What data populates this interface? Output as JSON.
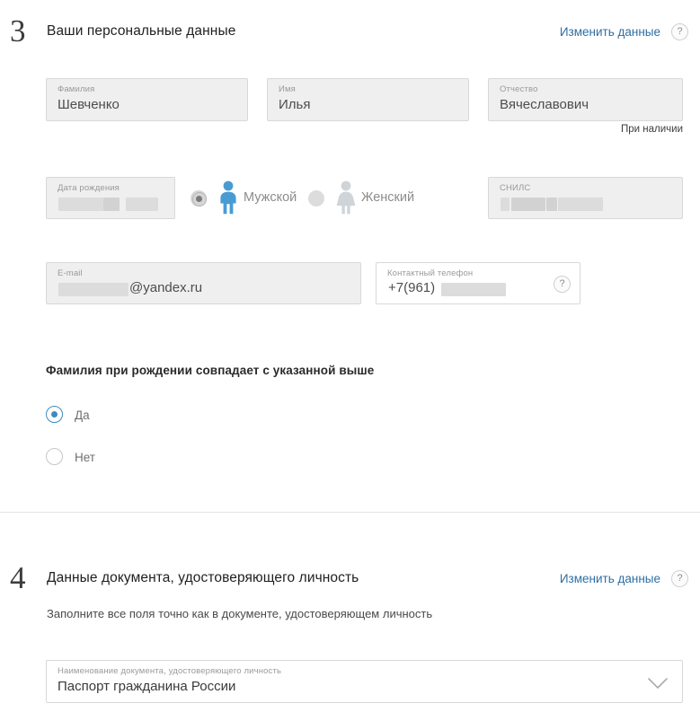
{
  "section3": {
    "number": "3",
    "title": "Ваши персональные данные",
    "edit_link": "Изменить данные",
    "help_icon": "question-mark-icon",
    "help_glyph": "?",
    "fields": {
      "lastname": {
        "label": "Фамилия",
        "value": "Шевченко"
      },
      "firstname": {
        "label": "Имя",
        "value": "Илья"
      },
      "middlename": {
        "label": "Отчество",
        "value": "Вячеславович",
        "hint": "При наличии"
      },
      "birthdate": {
        "label": "Дата рождения",
        "value": "",
        "redacted": true
      },
      "snils": {
        "label": "СНИЛС",
        "value": "",
        "redacted": true
      },
      "email": {
        "label": "E-mail",
        "value": "@yandex.ru",
        "redacted": true
      },
      "phone": {
        "label": "Контактный телефон",
        "value": "+7(961)",
        "redacted": true,
        "help_glyph": "?"
      }
    },
    "gender": {
      "male": {
        "label": "Мужской",
        "selected": true,
        "icon": "male-person-icon"
      },
      "female": {
        "label": "Женский",
        "selected": false,
        "icon": "female-person-icon"
      }
    },
    "birth_surname_question": {
      "title": "Фамилия при рождении совпадает с указанной выше",
      "options": [
        {
          "label": "Да",
          "selected": true
        },
        {
          "label": "Нет",
          "selected": false
        }
      ]
    }
  },
  "section4": {
    "number": "4",
    "title": "Данные документа, удостоверяющего личность",
    "edit_link": "Изменить данные",
    "help_glyph": "?",
    "subtitle": "Заполните все поля точно как в документе, удостоверяющем личность",
    "document_select": {
      "label": "Наименование документа, удостоверяющего личность",
      "value": "Паспорт гражданина России",
      "chevron": "chevron-down-icon"
    }
  },
  "colors": {
    "link": "#2e6ea3",
    "accent_radio": "#3d8bbf",
    "male_icon": "#4a9bd4",
    "female_icon": "#cfd4d8",
    "field_bg": "#efefef",
    "field_border": "#d8d8d8",
    "redaction": "#dcdcdc"
  }
}
